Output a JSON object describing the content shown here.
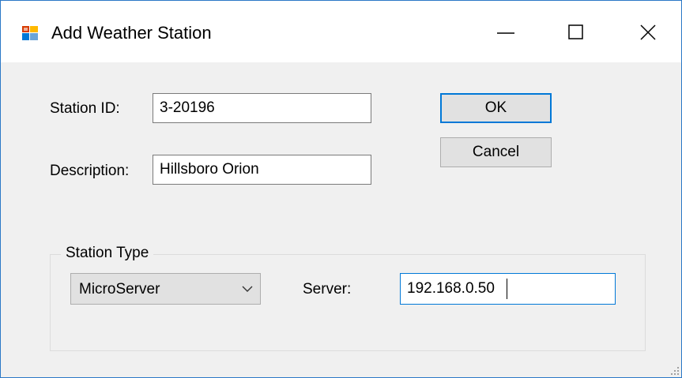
{
  "window": {
    "title": "Add Weather Station",
    "icon": "app-form-icon",
    "controls": {
      "minimize": "minimize-icon",
      "maximize": "maximize-icon",
      "close": "close-icon"
    }
  },
  "form": {
    "station_id_label": "Station ID:",
    "station_id_value": "3-20196",
    "description_label": "Description:",
    "description_value": "Hillsboro Orion",
    "ok_label": "OK",
    "cancel_label": "Cancel"
  },
  "station_type": {
    "group_label": "Station Type",
    "selected": "MicroServer",
    "server_label": "Server:",
    "server_value": "192.168.0.50"
  },
  "colors": {
    "accent": "#0078d7",
    "window_border": "#2b78c7",
    "client_bg": "#f0f0f0"
  }
}
